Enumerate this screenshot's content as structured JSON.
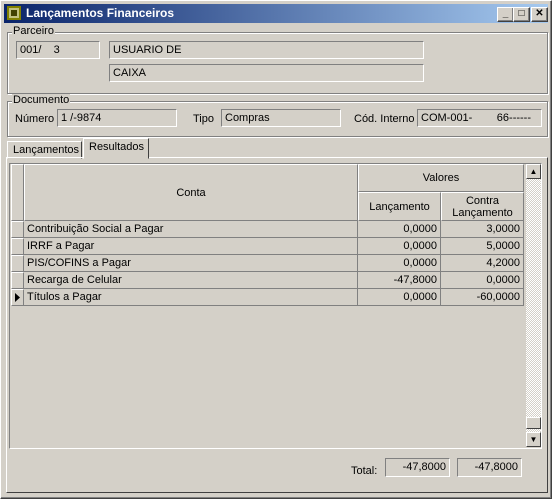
{
  "window": {
    "title": "Lançamentos Financeiros"
  },
  "parceiro": {
    "label": "Parceiro",
    "code": "001/    3",
    "name": "USUARIO DE",
    "sub": "CAIXA"
  },
  "documento": {
    "label": "Documento",
    "numero_label": "Número",
    "numero_value": "1 /-9874",
    "tipo_label": "Tipo",
    "tipo_value": "Compras",
    "cod_label": "Cód. Interno",
    "cod_value": "COM-001-        66------"
  },
  "tabs": [
    {
      "label": "Lançamentos"
    },
    {
      "label": "Resultados"
    }
  ],
  "grid": {
    "col_conta": "Conta",
    "col_valores": "Valores",
    "col_lancamento": "Lançamento",
    "col_contra": "Contra Lançamento",
    "rows": [
      {
        "conta": "Contribuição Social a Pagar",
        "lanc": "0,0000",
        "contra": "3,0000"
      },
      {
        "conta": "IRRF a Pagar",
        "lanc": "0,0000",
        "contra": "5,0000"
      },
      {
        "conta": "PIS/COFINS a Pagar",
        "lanc": "0,0000",
        "contra": "4,2000"
      },
      {
        "conta": "Recarga de Celular",
        "lanc": "-47,8000",
        "contra": "0,0000"
      },
      {
        "conta": "Títulos a Pagar",
        "lanc": "0,0000",
        "contra": "-60,0000"
      }
    ]
  },
  "total": {
    "label": "Total:",
    "lanc": "-47,8000",
    "contra": "-47,8000"
  }
}
